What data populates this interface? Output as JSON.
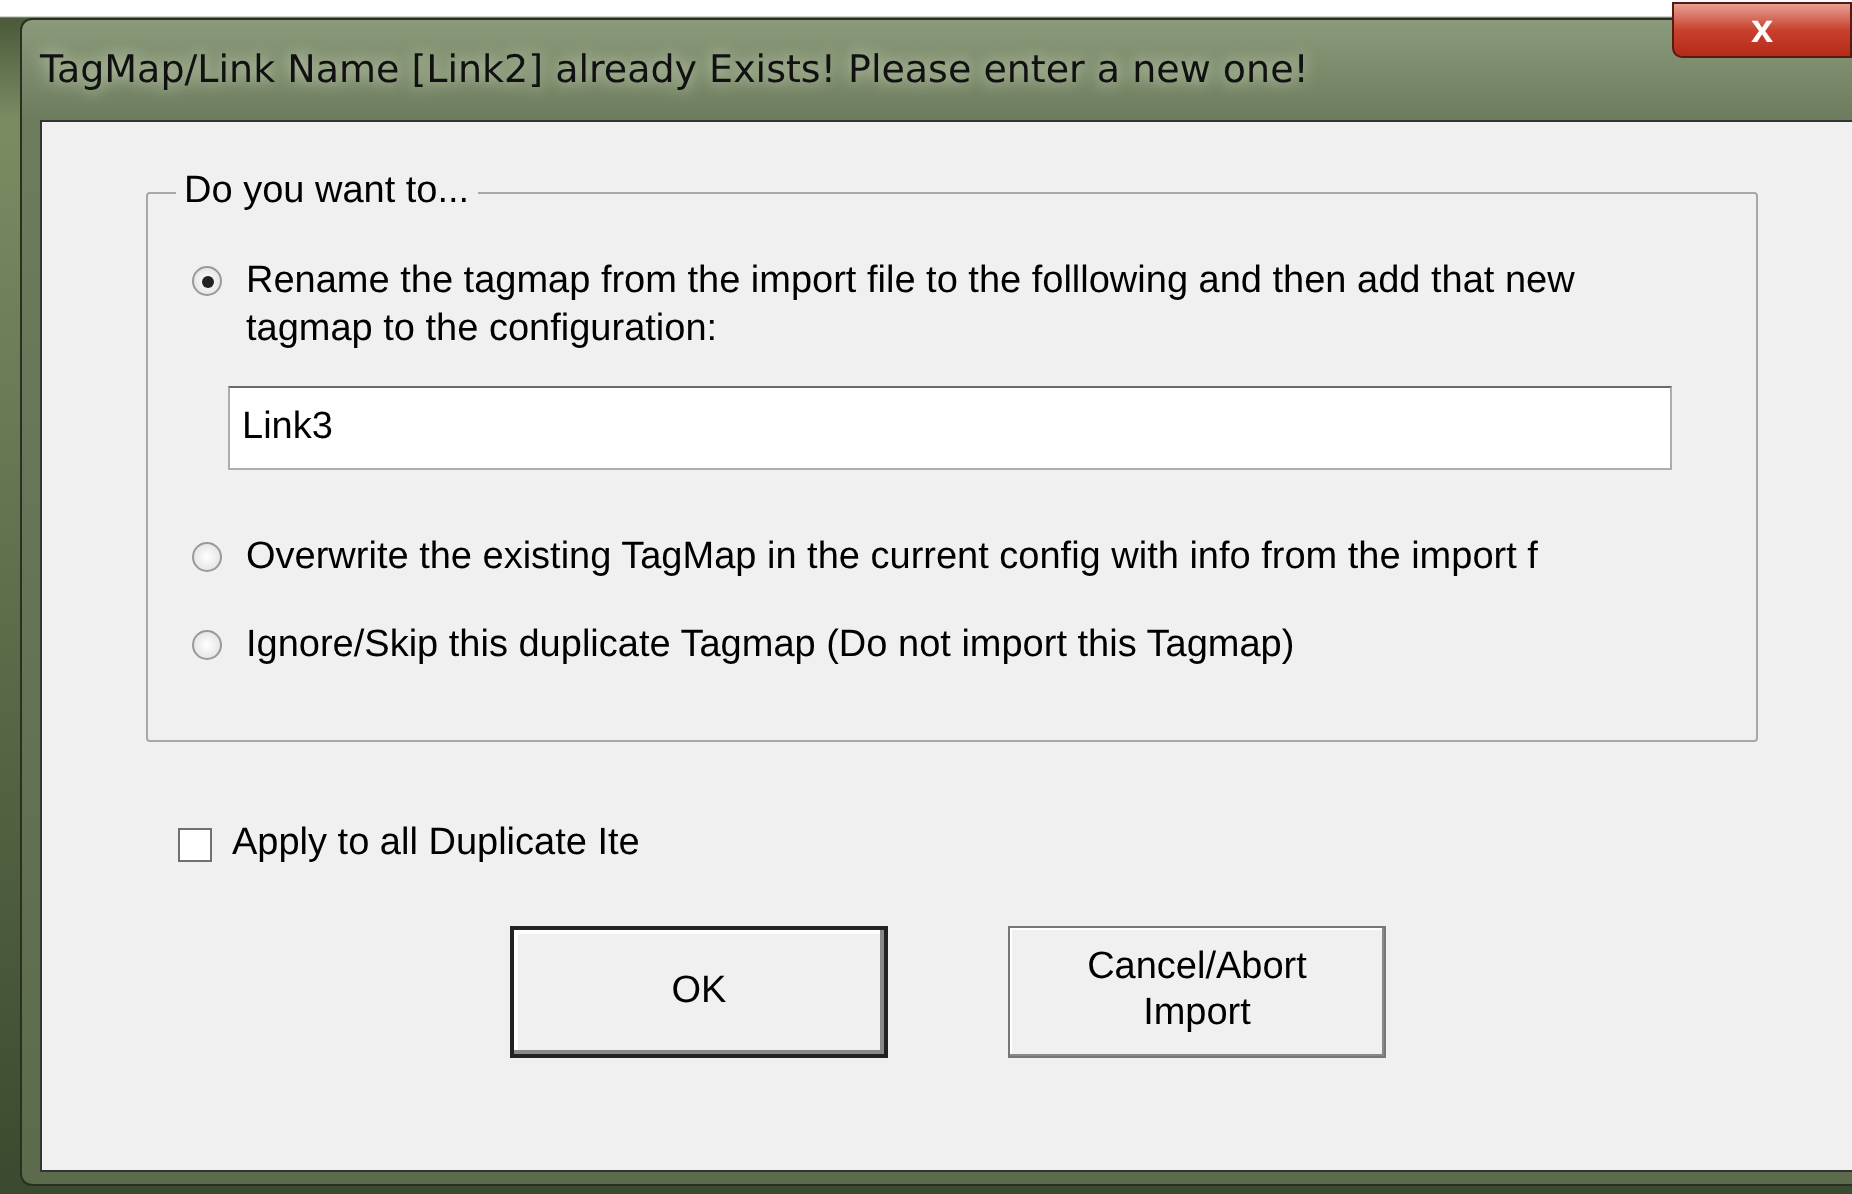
{
  "window": {
    "title": "TagMap/Link Name [Link2] already Exists! Please enter a new one!",
    "close": "x"
  },
  "group": {
    "title": "Do you want to...",
    "options": [
      {
        "label": "Rename the tagmap from the import file to the folllowing and then add that new tagmap to the configuration:",
        "selected": true
      },
      {
        "label": "Overwrite the existing TagMap in the current config with info from the import f",
        "selected": false
      },
      {
        "label": "Ignore/Skip this duplicate Tagmap (Do not import this Tagmap)",
        "selected": false
      }
    ],
    "name_field": {
      "value": "Link3"
    }
  },
  "apply_all": {
    "label": "Apply to all Duplicate Ite",
    "checked": false
  },
  "buttons": [
    {
      "label": "OK",
      "default": true
    },
    {
      "label": "Cancel/Abort Import",
      "default": false
    }
  ]
}
